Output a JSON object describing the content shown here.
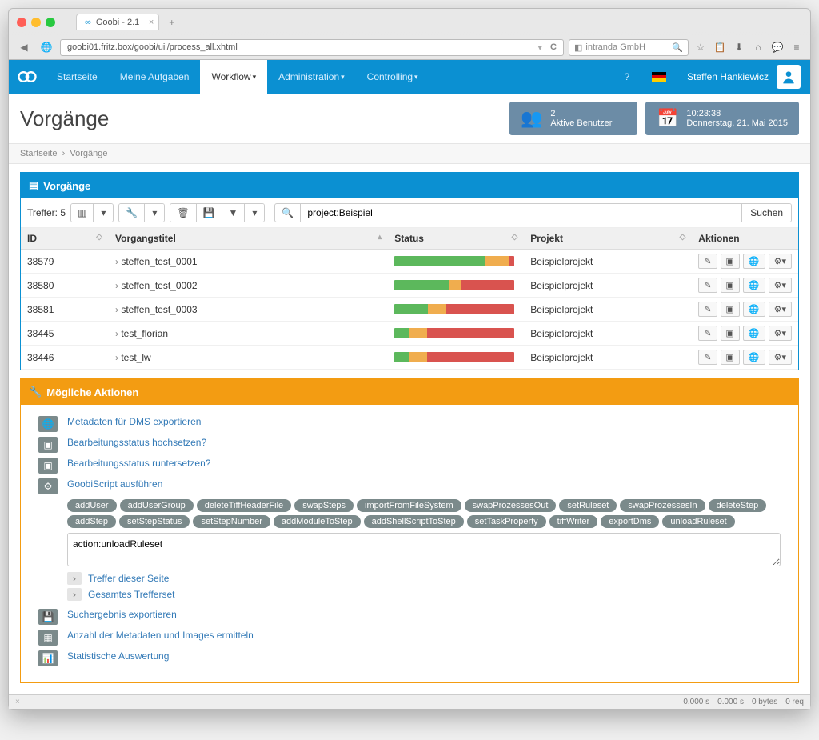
{
  "browser": {
    "tab_title": "Goobi - 2.1",
    "url": "goobi01.fritz.box/goobi/uii/process_all.xhtml",
    "search_placeholder": "intranda GmbH"
  },
  "nav": {
    "items": [
      "Startseite",
      "Meine Aufgaben",
      "Workflow",
      "Administration",
      "Controlling"
    ],
    "help": "?",
    "username": "Steffen Hankiewicz"
  },
  "header": {
    "title": "Vorgänge",
    "active_users_count": "2",
    "active_users_label": "Aktive Benutzer",
    "time": "10:23:38",
    "date": "Donnerstag, 21. Mai 2015"
  },
  "breadcrumb": {
    "home": "Startseite",
    "current": "Vorgänge"
  },
  "list": {
    "panel_title": "Vorgänge",
    "result_label": "Treffer: 5",
    "search_value": "project:Beispiel",
    "search_button": "Suchen",
    "columns": {
      "id": "ID",
      "title": "Vorgangstitel",
      "status": "Status",
      "project": "Projekt",
      "actions": "Aktionen"
    },
    "rows": [
      {
        "id": "38579",
        "title": "steffen_test_0001",
        "project": "Beispielprojekt",
        "status": [
          75,
          20,
          5
        ]
      },
      {
        "id": "38580",
        "title": "steffen_test_0002",
        "project": "Beispielprojekt",
        "status": [
          45,
          10,
          45
        ]
      },
      {
        "id": "38581",
        "title": "steffen_test_0003",
        "project": "Beispielprojekt",
        "status": [
          28,
          15,
          57
        ]
      },
      {
        "id": "38445",
        "title": "test_florian",
        "project": "Beispielprojekt",
        "status": [
          12,
          15,
          73
        ]
      },
      {
        "id": "38446",
        "title": "test_lw",
        "project": "Beispielprojekt",
        "status": [
          12,
          15,
          73
        ]
      }
    ]
  },
  "actions_panel": {
    "title": "Mögliche Aktionen",
    "items": {
      "export_dms": "Metadaten für DMS exportieren",
      "status_up": "Bearbeitungsstatus hochsetzen?",
      "status_down": "Bearbeitungsstatus runtersetzen?",
      "run_script": "GoobiScript ausführen",
      "page_hits": "Treffer dieser Seite",
      "all_hits": "Gesamtes Trefferset",
      "export_result": "Suchergebnis exportieren",
      "count_meta": "Anzahl der Metadaten und Images ermitteln",
      "stats": "Statistische Auswertung"
    },
    "script_pills": [
      "addUser",
      "addUserGroup",
      "deleteTiffHeaderFile",
      "swapSteps",
      "importFromFileSystem",
      "swapProzessesOut",
      "setRuleset",
      "swapProzessesIn",
      "deleteStep",
      "addStep",
      "setStepStatus",
      "setStepNumber",
      "addModuleToStep",
      "addShellScriptToStep",
      "setTaskProperty",
      "tiffWriter",
      "exportDms",
      "unloadRuleset"
    ],
    "script_value": "action:unloadRuleset"
  },
  "footer": {
    "t1": "0.000 s",
    "t2": "0.000 s",
    "bytes": "0 bytes",
    "req": "0 req"
  }
}
